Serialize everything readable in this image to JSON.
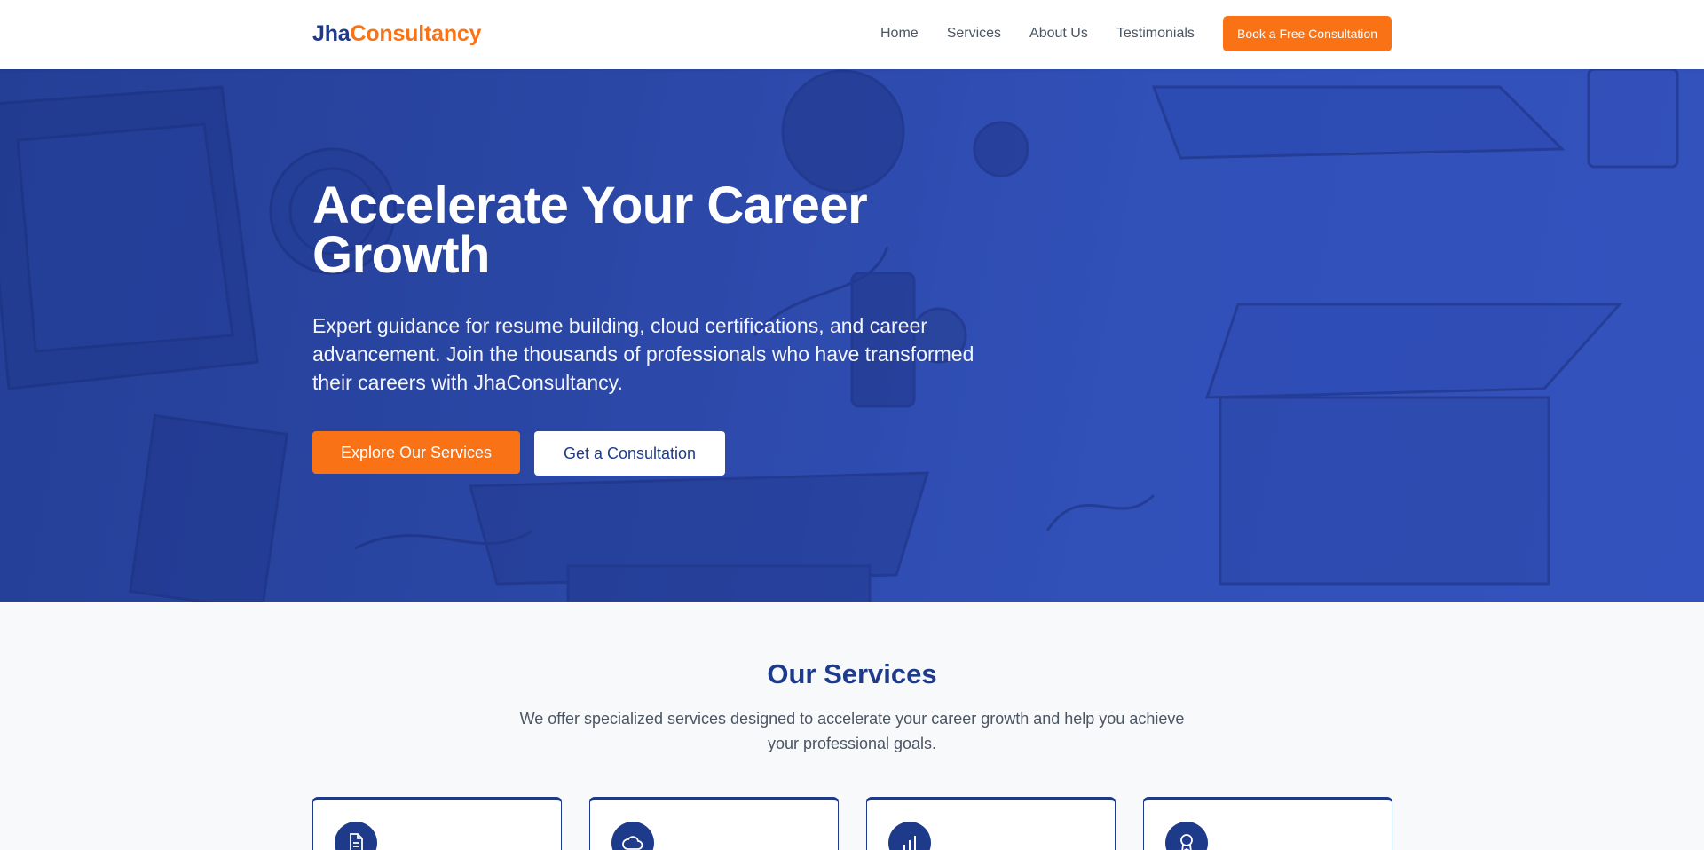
{
  "header": {
    "logo_part1": "Jha",
    "logo_part2": "Consultancy",
    "nav": [
      "Home",
      "Services",
      "About Us",
      "Testimonials"
    ],
    "cta": "Book a Free Consultation"
  },
  "hero": {
    "title": "Accelerate Your Career Growth",
    "subtitle": "Expert guidance for resume building, cloud certifications, and career advancement. Join the thousands of professionals who have transformed their careers with JhaConsultancy.",
    "primary_button": "Explore Our Services",
    "secondary_button": "Get a Consultation"
  },
  "services": {
    "title": "Our Services",
    "subtitle": "We offer specialized services designed to accelerate your career growth and help you achieve your professional goals.",
    "cards": [
      {
        "icon": "document-icon"
      },
      {
        "icon": "cloud-icon"
      },
      {
        "icon": "bar-chart-icon"
      },
      {
        "icon": "award-icon"
      }
    ]
  },
  "colors": {
    "primary": "#1e3a8a",
    "accent": "#f97316",
    "hero_overlay": "#2b47a6"
  }
}
